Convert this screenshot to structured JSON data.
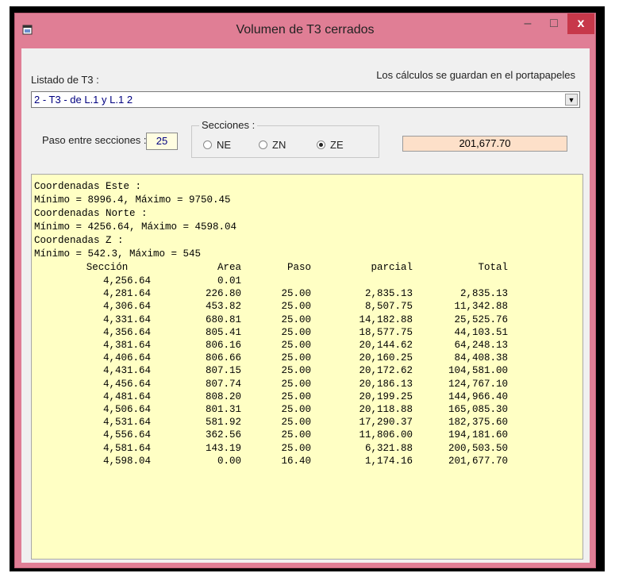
{
  "window": {
    "title": "Volumen de T3 cerrados",
    "minimize": "–",
    "maximize": "□",
    "close": "x"
  },
  "form": {
    "listado_label": "Listado de T3 :",
    "clipboard_note": "Los cálculos se guardan en el portapapeles",
    "selected_t3": "2 - T3 - de L.1 y L.1 2",
    "paso_label": "Paso entre secciones :",
    "paso_value": "25",
    "secciones_label": "Secciones :",
    "options": [
      {
        "label": "NE",
        "selected": false
      },
      {
        "label": "ZN",
        "selected": false
      },
      {
        "label": "ZE",
        "selected": true
      }
    ],
    "result_value": "201,677.70"
  },
  "output": {
    "header_lines": [
      "Coordenadas Este :",
      "Mínimo = 8996.4, Máximo = 9750.45",
      "Coordenadas Norte :",
      "Mínimo = 4256.64, Máximo = 4598.04",
      "Coordenadas Z :",
      "Mínimo = 542.3, Máximo = 545"
    ],
    "columns": [
      "Sección",
      "Area",
      "Paso",
      "parcial",
      "Total"
    ],
    "rows": [
      [
        "4,256.64",
        "0.01",
        "",
        "",
        ""
      ],
      [
        "4,281.64",
        "226.80",
        "25.00",
        "2,835.13",
        "2,835.13"
      ],
      [
        "4,306.64",
        "453.82",
        "25.00",
        "8,507.75",
        "11,342.88"
      ],
      [
        "4,331.64",
        "680.81",
        "25.00",
        "14,182.88",
        "25,525.76"
      ],
      [
        "4,356.64",
        "805.41",
        "25.00",
        "18,577.75",
        "44,103.51"
      ],
      [
        "4,381.64",
        "806.16",
        "25.00",
        "20,144.62",
        "64,248.13"
      ],
      [
        "4,406.64",
        "806.66",
        "25.00",
        "20,160.25",
        "84,408.38"
      ],
      [
        "4,431.64",
        "807.15",
        "25.00",
        "20,172.62",
        "104,581.00"
      ],
      [
        "4,456.64",
        "807.74",
        "25.00",
        "20,186.13",
        "124,767.10"
      ],
      [
        "4,481.64",
        "808.20",
        "25.00",
        "20,199.25",
        "144,966.40"
      ],
      [
        "4,506.64",
        "801.31",
        "25.00",
        "20,118.88",
        "165,085.30"
      ],
      [
        "4,531.64",
        "581.92",
        "25.00",
        "17,290.37",
        "182,375.60"
      ],
      [
        "4,556.64",
        "362.56",
        "25.00",
        "11,806.00",
        "194,181.60"
      ],
      [
        "4,581.64",
        "143.19",
        "25.00",
        "6,321.88",
        "200,503.50"
      ],
      [
        "4,598.04",
        "0.00",
        "16.40",
        "1,174.16",
        "201,677.70"
      ]
    ]
  },
  "colors": {
    "title_bar": "#e07e95",
    "close_button": "#c7384a",
    "output_background": "#ffffc4",
    "result_background": "#fde0c9"
  }
}
